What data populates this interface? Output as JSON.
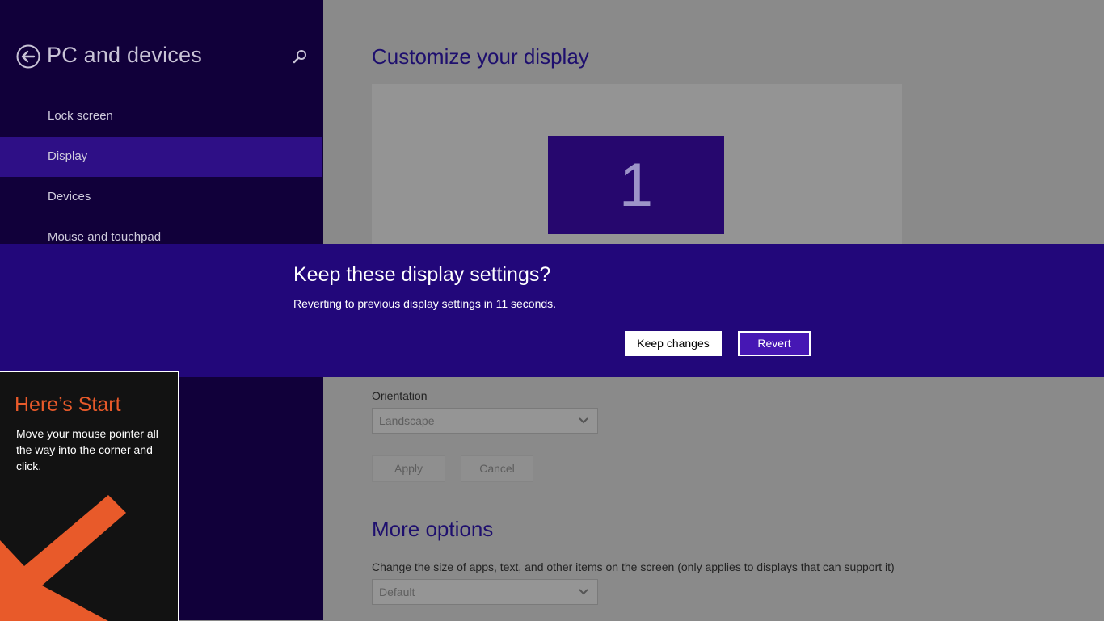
{
  "sidebar": {
    "title": "PC and devices",
    "items": [
      {
        "label": "Lock screen",
        "selected": false
      },
      {
        "label": "Display",
        "selected": true
      },
      {
        "label": "Devices",
        "selected": false
      },
      {
        "label": "Mouse and touchpad",
        "selected": false
      }
    ]
  },
  "content": {
    "title": "Customize your display",
    "monitor_number": "1",
    "orientation_label": "Orientation",
    "orientation_value": "Landscape",
    "apply_label": "Apply",
    "cancel_label": "Cancel",
    "more_options_title": "More options",
    "size_label": "Change the size of apps, text, and other items on the screen (only applies to displays that can support it)",
    "size_value": "Default"
  },
  "dialog": {
    "title": "Keep these display settings?",
    "message": "Reverting to previous display settings in 11 seconds.",
    "keep_label": "Keep changes",
    "revert_label": "Revert"
  },
  "start_tip": {
    "title": "Here’s Start",
    "body": "Move your mouse pointer all the way into the corner and click."
  },
  "colors": {
    "sidebar_bg": "#11003a",
    "selected_bg": "#2e0f86",
    "banner_bg": "#22077a",
    "tip_accent": "#e85a2a"
  }
}
